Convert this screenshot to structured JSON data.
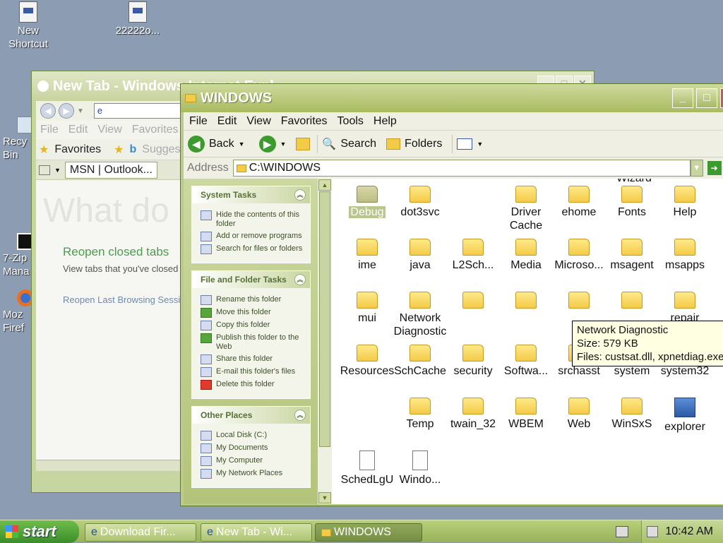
{
  "desktop": {
    "icons": [
      {
        "label": "New\nShortcut"
      },
      {
        "label": "22222o..."
      }
    ],
    "side_icons": [
      {
        "label": "Recy\nBin"
      },
      {
        "label": "7-Zip\nMana"
      },
      {
        "label": "Moz\nFiref"
      }
    ]
  },
  "ie_window": {
    "title": "New Tab - Windows Internet Expl",
    "url": "e",
    "menu": [
      "File",
      "Edit",
      "View",
      "Favorites"
    ],
    "favorites_label": "Favorites",
    "suggested_label": "Suggest",
    "tab_label": "MSN | Outlook...",
    "big_text": "What do",
    "reopen_closed_tabs": "Reopen closed tabs",
    "view_tabs": "View tabs that you've closed",
    "reopen_last_session": "Reopen Last Browsing Sessio"
  },
  "explorer": {
    "title": "WINDOWS",
    "menu": [
      "File",
      "Edit",
      "View",
      "Favorites",
      "Tools",
      "Help"
    ],
    "toolbar": {
      "back": "Back",
      "search": "Search",
      "folders": "Folders"
    },
    "address_label": "Address",
    "address_value": "C:\\WINDOWS",
    "system_tasks": {
      "title": "System Tasks",
      "items": [
        "Hide the contents of this folder",
        "Add or remove programs",
        "Search for files or folders"
      ]
    },
    "file_folder_tasks": {
      "title": "File and Folder Tasks",
      "items": [
        "Rename this folder",
        "Move this folder",
        "Copy this folder",
        "Publish this folder to the Web",
        "Share this folder",
        "E-mail this folder's files",
        "Delete this folder"
      ]
    },
    "other_places": {
      "title": "Other Places",
      "items": [
        "Local Disk (C:)",
        "My Documents",
        "My Computer",
        "My Network Places"
      ]
    },
    "partial_top_label": "Wizard",
    "files": [
      {
        "label": "Debug",
        "kind": "folder",
        "selected": true
      },
      {
        "label": "dot3svc",
        "kind": "folder"
      },
      {
        "label": "Driver Cache",
        "kind": "folder"
      },
      {
        "label": "ehome",
        "kind": "folder"
      },
      {
        "label": "Fonts",
        "kind": "folder"
      },
      {
        "label": "Help",
        "kind": "folder"
      },
      {
        "label": "ime",
        "kind": "folder"
      },
      {
        "label": "java",
        "kind": "folder"
      },
      {
        "label": "L2Sch...",
        "kind": "folder"
      },
      {
        "label": "Media",
        "kind": "folder"
      },
      {
        "label": "Microso...",
        "kind": "folder"
      },
      {
        "label": "msagent",
        "kind": "folder"
      },
      {
        "label": "msapps",
        "kind": "folder"
      },
      {
        "label": "mui",
        "kind": "folder"
      },
      {
        "label": "Network Diagnostic",
        "kind": "folder"
      },
      {
        "label": "repair",
        "kind": "folder"
      },
      {
        "label": "Resources",
        "kind": "folder"
      },
      {
        "label": "SchCache",
        "kind": "folder"
      },
      {
        "label": "security",
        "kind": "folder"
      },
      {
        "label": "Softwa...",
        "kind": "folder"
      },
      {
        "label": "srchasst",
        "kind": "folder"
      },
      {
        "label": "system",
        "kind": "folder"
      },
      {
        "label": "system32",
        "kind": "folder"
      },
      {
        "label": "Temp",
        "kind": "folder"
      },
      {
        "label": "twain_32",
        "kind": "folder"
      },
      {
        "label": "WBEM",
        "kind": "folder"
      },
      {
        "label": "Web",
        "kind": "folder"
      },
      {
        "label": "WinSxS",
        "kind": "folder"
      },
      {
        "label": "explorer",
        "kind": "exe"
      },
      {
        "label": "SchedLgU",
        "kind": "doc"
      },
      {
        "label": "Windo...",
        "kind": "doc"
      }
    ],
    "tooltip": {
      "name": "Network Diagnostic",
      "size": "Size: 579 KB",
      "files": "Files: custsat.dll, xpnetdiag.exe, xpnetdiag.xsl"
    }
  },
  "taskbar": {
    "start": "start",
    "buttons": [
      "Download Fir...",
      "New Tab - Wi...",
      "WINDOWS"
    ],
    "clock": "10:42 AM"
  }
}
